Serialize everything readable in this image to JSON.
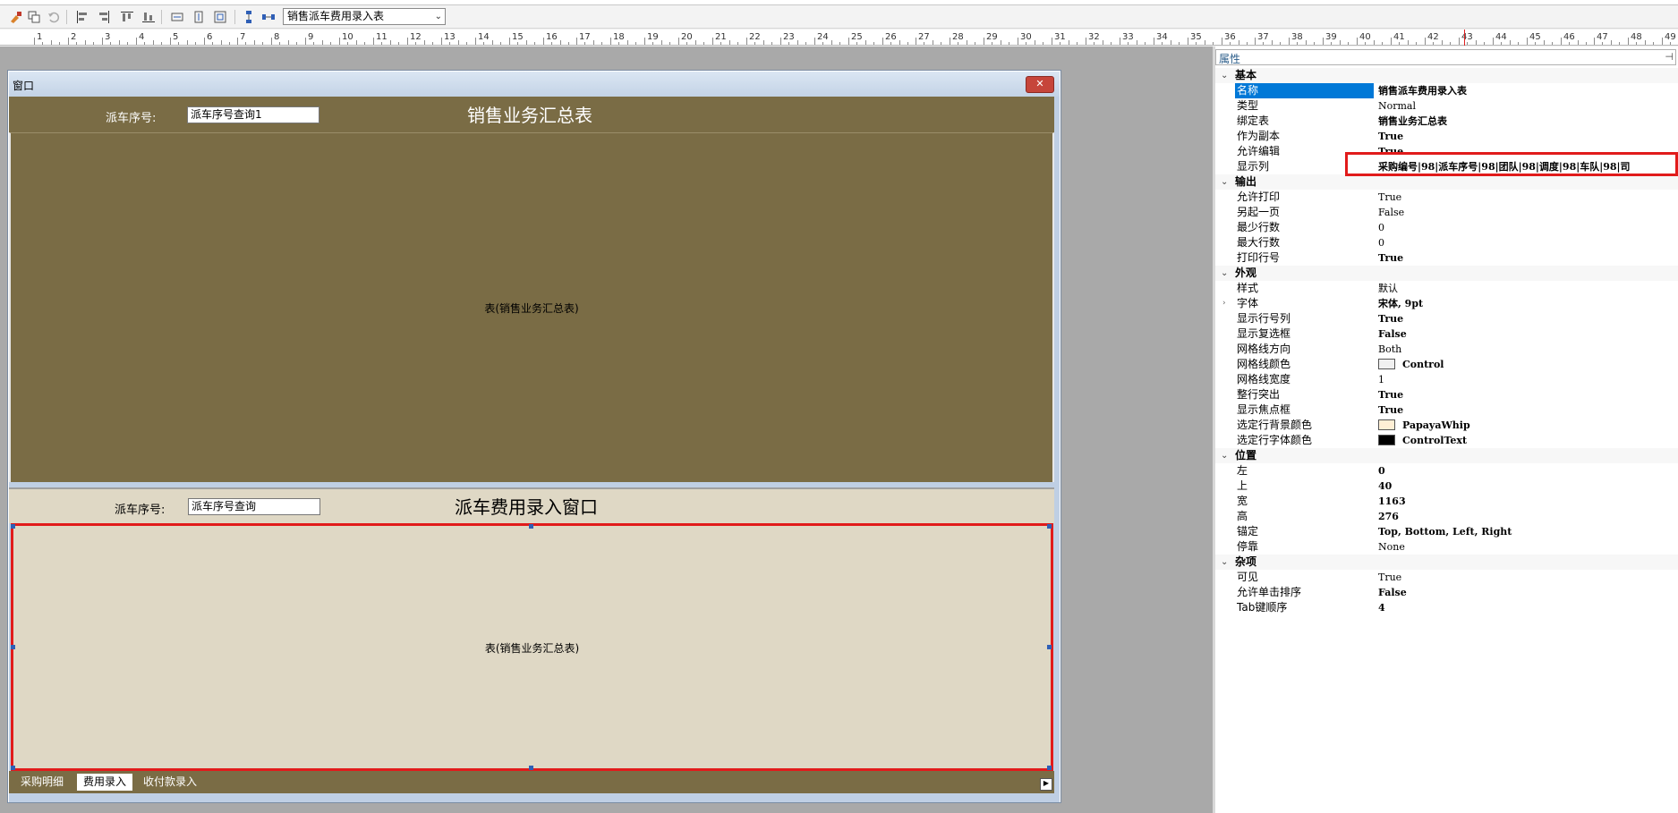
{
  "toolbar": {
    "report_select": "销售派车费用录入表"
  },
  "ruler": {
    "numbers": [
      "1",
      "2",
      "3",
      "4",
      "5",
      "6",
      "7",
      "8",
      "9",
      "10",
      "11",
      "12",
      "13",
      "14",
      "15",
      "16",
      "17",
      "18",
      "19",
      "20",
      "21",
      "22",
      "23",
      "24",
      "25",
      "26",
      "27",
      "28",
      "29",
      "30",
      "31",
      "32",
      "33",
      "34",
      "35",
      "36",
      "37",
      "38",
      "39",
      "40",
      "41",
      "42",
      "43",
      "44",
      "45",
      "46",
      "47",
      "48",
      "49"
    ]
  },
  "window": {
    "title": "窗口",
    "close_label": "✕",
    "upper_panel": {
      "label": "派车序号:",
      "input_value": "派车序号查询1",
      "title": "销售业务汇总表",
      "grid_caption": "表(销售业务汇总表)"
    },
    "lower_panel": {
      "label": "派车序号:",
      "input_value": "派车序号查询",
      "title": "派车费用录入窗口",
      "grid_caption": "表(销售业务汇总表)"
    },
    "tabs": [
      "采购明细",
      "费用录入",
      "收付款录入"
    ],
    "active_tab": "费用录入"
  },
  "properties": {
    "search_placeholder": "属性",
    "categories": [
      {
        "name": "基本",
        "rows": [
          {
            "name": "名称",
            "value": "销售派车费用录入表",
            "bold": true,
            "selected": true
          },
          {
            "name": "类型",
            "value": "Normal",
            "bold": false
          },
          {
            "name": "绑定表",
            "value": "销售业务汇总表",
            "bold": true
          },
          {
            "name": "作为副本",
            "value": "True",
            "bold": true
          },
          {
            "name": "允许编辑",
            "value": "True",
            "bold": true
          },
          {
            "name": "显示列",
            "value": "采购编号|98|派车序号|98|团队|98|调度|98|车队|98|司",
            "bold": true
          }
        ]
      },
      {
        "name": "输出",
        "rows": [
          {
            "name": "允许打印",
            "value": "True",
            "bold": false
          },
          {
            "name": "另起一页",
            "value": "False",
            "bold": false
          },
          {
            "name": "最少行数",
            "value": "0",
            "bold": false
          },
          {
            "name": "最大行数",
            "value": "0",
            "bold": false
          },
          {
            "name": "打印行号",
            "value": "True",
            "bold": true
          }
        ]
      },
      {
        "name": "外观",
        "rows": [
          {
            "name": "样式",
            "value": "默认",
            "bold": false
          },
          {
            "name": "字体",
            "value": "宋体, 9pt",
            "bold": true,
            "expandable": true
          },
          {
            "name": "显示行号列",
            "value": "True",
            "bold": true
          },
          {
            "name": "显示复选框",
            "value": "False",
            "bold": true
          },
          {
            "name": "网格线方向",
            "value": "Both",
            "bold": false
          },
          {
            "name": "网格线颜色",
            "value": "Control",
            "bold": true,
            "swatch": "#f0f0f0"
          },
          {
            "name": "网格线宽度",
            "value": "1",
            "bold": false
          },
          {
            "name": "整行突出",
            "value": "True",
            "bold": true
          },
          {
            "name": "显示焦点框",
            "value": "True",
            "bold": true
          },
          {
            "name": "选定行背景颜色",
            "value": "PapayaWhip",
            "bold": true,
            "swatch": "#ffefd5"
          },
          {
            "name": "选定行字体颜色",
            "value": "ControlText",
            "bold": true,
            "swatch": "#000000"
          }
        ]
      },
      {
        "name": "位置",
        "rows": [
          {
            "name": "左",
            "value": "0",
            "bold": true
          },
          {
            "name": "上",
            "value": "40",
            "bold": true
          },
          {
            "name": "宽",
            "value": "1163",
            "bold": true
          },
          {
            "name": "高",
            "value": "276",
            "bold": true
          },
          {
            "name": "锚定",
            "value": "Top, Bottom, Left, Right",
            "bold": true
          },
          {
            "name": "停靠",
            "value": "None",
            "bold": false
          }
        ]
      },
      {
        "name": "杂项",
        "rows": [
          {
            "name": "可见",
            "value": "True",
            "bold": false
          },
          {
            "name": "允许单击排序",
            "value": "False",
            "bold": true
          },
          {
            "name": "Tab键顺序",
            "value": "4",
            "bold": true
          }
        ]
      }
    ]
  },
  "colors": {
    "upper_panel_bg": "#7a6c45",
    "lower_panel_bg": "#dfd8c5",
    "highlight_red": "#e11b1b",
    "selection_blue": "#0078d7"
  }
}
